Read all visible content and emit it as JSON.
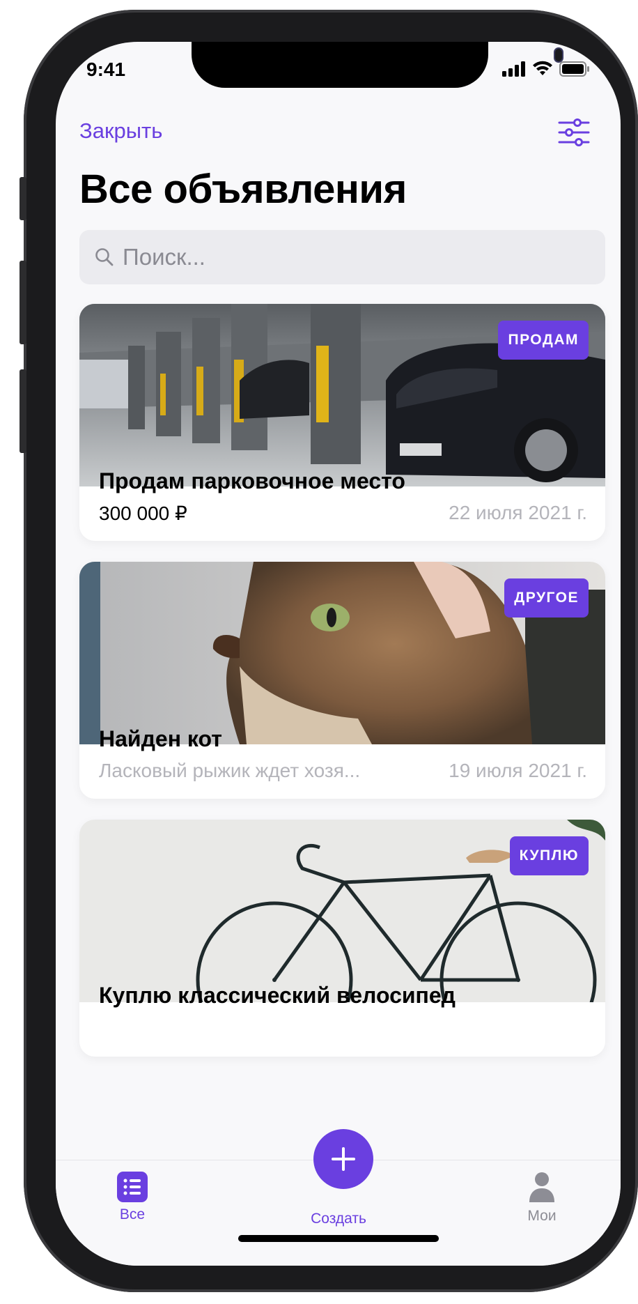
{
  "status_bar": {
    "time": "9:41",
    "icons": [
      "signal-icon",
      "wifi-icon",
      "battery-icon"
    ]
  },
  "header": {
    "close_label": "Закрыть",
    "filter_icon": "filter-sliders-icon",
    "title": "Все объявления"
  },
  "search": {
    "placeholder": "Поиск...",
    "icon": "search-icon"
  },
  "listings": [
    {
      "badge": "ПРОДАМ",
      "title": "Продам парковочное место",
      "subtitle": "300 000 ₽",
      "date": "22 июля 2021 г.",
      "image": "parking-garage-photo"
    },
    {
      "badge": "ДРУГОЕ",
      "title": "Найден кот",
      "subtitle": "Ласковый рыжик ждет хозя...",
      "date": "19 июля 2021 г.",
      "image": "cat-photo"
    },
    {
      "badge": "КУПЛЮ",
      "title": "Куплю классический велосипед",
      "image": "bicycle-photo"
    }
  ],
  "tabbar": {
    "tabs": [
      {
        "label": "Все",
        "icon": "list-icon",
        "active": true
      },
      {
        "label": "Создать",
        "icon": "plus-icon",
        "active": false
      },
      {
        "label": "Мои",
        "icon": "person-icon",
        "active": false
      }
    ]
  },
  "colors": {
    "accent": "#6a3fe0",
    "muted_text": "#b4b4ba",
    "background": "#f8f8fa"
  }
}
